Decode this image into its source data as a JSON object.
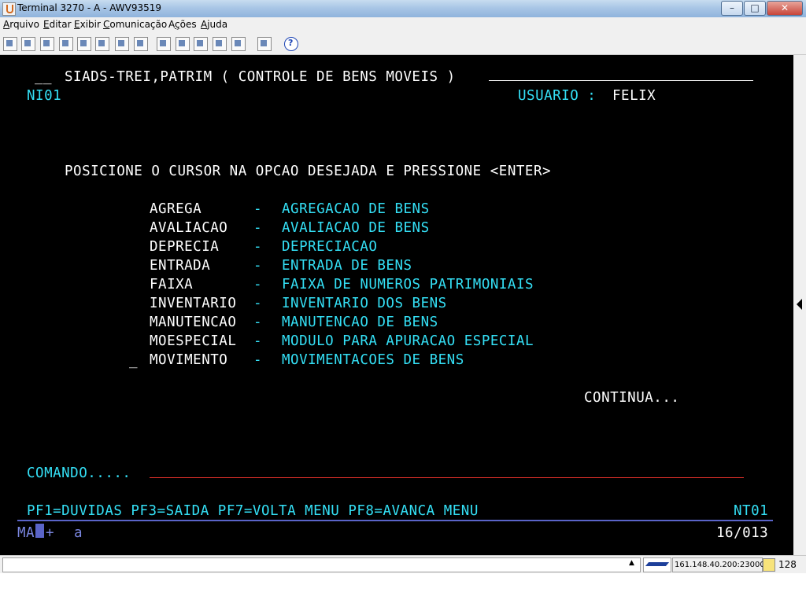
{
  "window": {
    "title": "Terminal 3270 - A - AWV93519",
    "buttons": {
      "minimize": "–",
      "maximize": "□",
      "close": "✕"
    }
  },
  "menu": [
    "Arquivo",
    "Editar",
    "Exibir",
    "Comunicação",
    "Ações",
    "Ajuda"
  ],
  "menu_underline_index": [
    0,
    0,
    0,
    0,
    1,
    0
  ],
  "toolbar_icons": [
    "print-icon",
    "print-setup-icon",
    "send-file-icon",
    "copy-icon",
    "paste-icon",
    "tools-icon",
    "keypad-icon",
    "connect-icon",
    "disconnect-icon",
    "record-icon",
    "macro-icon",
    "options-icon",
    "help-icon"
  ],
  "screen": {
    "header_underscores": "__",
    "header_title": "SIADS-TREI,PATRIM ( CONTROLE DE BENS MOVEIS )",
    "screen_id": "NI01",
    "user_label": "USUARIO :",
    "user_name": "FELIX",
    "instruction": "POSICIONE O CURSOR NA OPCAO DESEJADA E PRESSIONE <ENTER>",
    "options": [
      {
        "code": "AGREGA",
        "sep": "-",
        "desc": "AGREGACAO DE BENS"
      },
      {
        "code": "AVALIACAO",
        "sep": "-",
        "desc": "AVALIACAO DE BENS"
      },
      {
        "code": "DEPRECIA",
        "sep": "-",
        "desc": "DEPRECIACAO"
      },
      {
        "code": "ENTRADA",
        "sep": "-",
        "desc": "ENTRADA DE BENS"
      },
      {
        "code": "FAIXA",
        "sep": "-",
        "desc": "FAIXA DE NUMEROS PATRIMONIAIS"
      },
      {
        "code": "INVENTARIO",
        "sep": "-",
        "desc": "INVENTARIO DOS BENS"
      },
      {
        "code": "MANUTENCAO",
        "sep": "-",
        "desc": "MANUTENCAO DE BENS"
      },
      {
        "code": "MOESPECIAL",
        "sep": "-",
        "desc": "MODULO PARA APURACAO ESPECIAL"
      },
      {
        "code": "MOVIMENTO",
        "sep": "-",
        "desc": "MOVIMENTACOES DE BENS"
      }
    ],
    "cursor_marker": "_",
    "continue": "CONTINUA...",
    "command_label": "COMANDO.....",
    "command_value": "",
    "pf_keys": "PF1=DUVIDAS PF3=SAIDA PF7=VOLTA MENU PF8=AVANCA MENU",
    "screen_code": "NT01"
  },
  "oia": {
    "mode": "MA",
    "plus": "+",
    "indicator": "a",
    "cursor_pos": "16/013"
  },
  "statusbar": {
    "host": "161.148.40.200:23000",
    "number": "128"
  }
}
